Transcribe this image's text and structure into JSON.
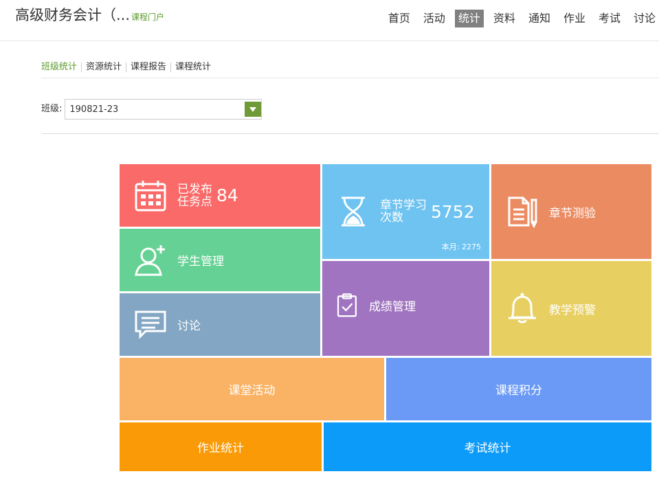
{
  "header": {
    "course_title": "高级财务会计（...",
    "portal_link": "课程门户",
    "nav": [
      "首页",
      "活动",
      "统计",
      "资料",
      "通知",
      "作业",
      "考试",
      "讨论"
    ],
    "active_nav": "统计"
  },
  "subnav": [
    "班级统计",
    "资源统计",
    "课程报告",
    "课程统计"
  ],
  "class_select": {
    "label": "班级:",
    "value": "190821-23"
  },
  "tiles": {
    "task": {
      "line1": "已发布",
      "line2": "任务点",
      "count": "84",
      "icon": "calendar-icon",
      "color": "#f96a69"
    },
    "chapter": {
      "line1": "章节学习",
      "line2": "次数",
      "count": "5752",
      "month": "本月: 2275",
      "icon": "hourglass-icon",
      "color": "#6ec3f1"
    },
    "quiz": {
      "label": "章节测验",
      "icon": "document-pen-icon",
      "color": "#eb8b62"
    },
    "student": {
      "label": "学生管理",
      "icon": "user-add-icon",
      "color": "#66d194"
    },
    "score": {
      "label": "成绩管理",
      "icon": "clipboard-check-icon",
      "color": "#a074c0"
    },
    "warning": {
      "label": "教学预警",
      "icon": "bell-icon",
      "color": "#e8cf62"
    },
    "discuss": {
      "label": "讨论",
      "icon": "chat-icon",
      "color": "#82a6c3"
    },
    "activity": {
      "label": "课堂活动",
      "color": "#fab364"
    },
    "points": {
      "label": "课程积分",
      "color": "#6a9af5"
    },
    "homework": {
      "label": "作业统计",
      "color": "#fa9a06"
    },
    "exam": {
      "label": "考试统计",
      "color": "#0c9bf9"
    }
  }
}
